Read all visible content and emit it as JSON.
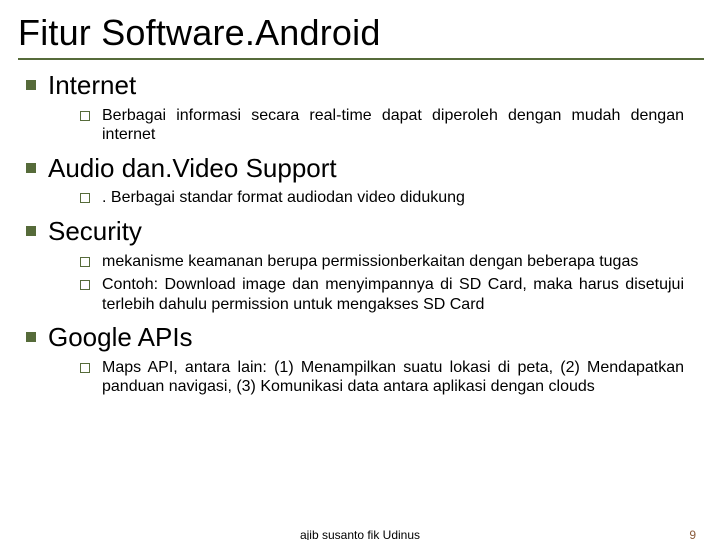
{
  "title": "Fitur Software.Android",
  "sections": [
    {
      "heading": "Internet",
      "items": [
        "Berbagai informasi secara real-time dapat diperoleh dengan mudah dengan internet"
      ]
    },
    {
      "heading": "Audio dan.Video Support",
      "items": [
        ". Berbagai standar format audiodan video didukung"
      ]
    },
    {
      "heading": "Security",
      "items": [
        "mekanisme keamanan berupa   permissionberkaitan dengan beberapa tugas",
        "Contoh: Download  image dan menyimpannya di SD Card, maka harus disetujui  terlebih dahulu permission untuk mengakses SD Card"
      ]
    },
    {
      "heading": "Google APIs",
      "items": [
        "Maps API, antara lain: (1) Menampilkan suatu lokasi di peta, (2) Mendapatkan panduan navigasi, (3) Komunikasi data antara aplikasi dengan clouds"
      ]
    }
  ],
  "footer_center": "ajib susanto fik Udinus",
  "footer_right": "9"
}
